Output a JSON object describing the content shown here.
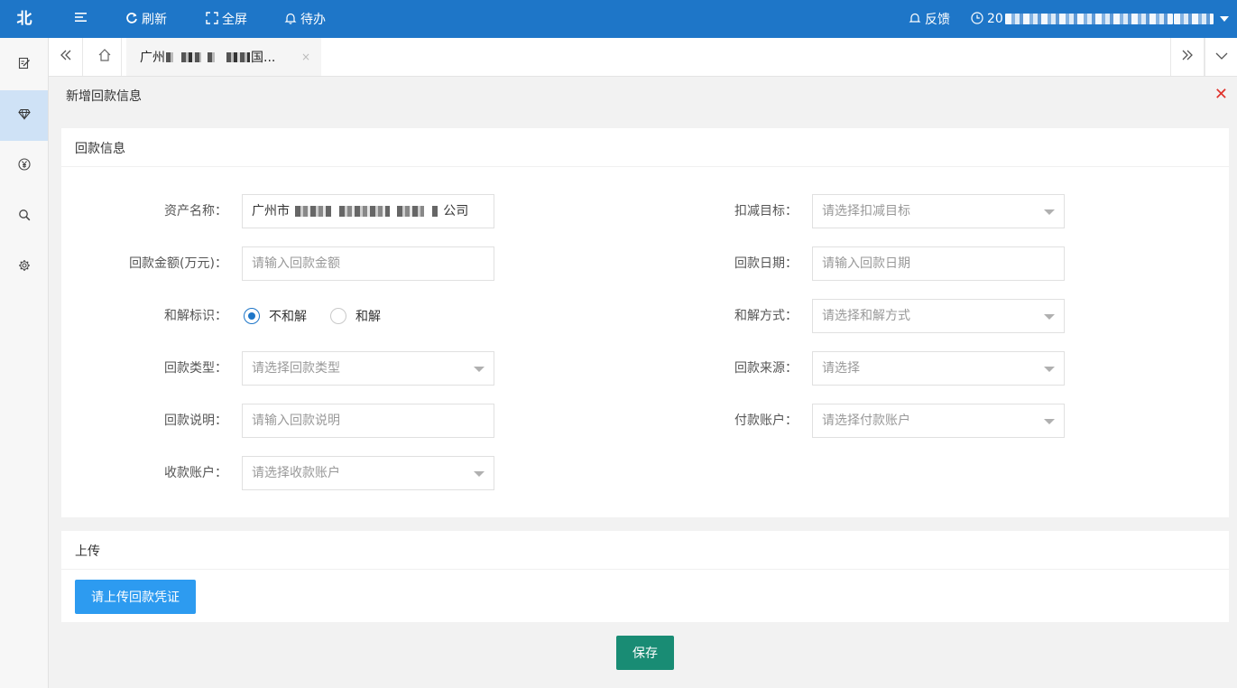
{
  "topbar": {
    "logo": "北",
    "menu_icon": "menu-icon",
    "refresh_label": "刷新",
    "fullscreen_label": "全屏",
    "todo_label": "待办",
    "feedback_label": "反馈",
    "datetime_prefix": "20",
    "bg_color": "#1e76c8"
  },
  "sidebar": {
    "items": [
      {
        "icon": "edit-doc-icon",
        "active": false
      },
      {
        "icon": "diamond-icon",
        "active": true
      },
      {
        "icon": "yen-icon",
        "active": false
      },
      {
        "icon": "search-icon",
        "active": false
      },
      {
        "icon": "gear-icon",
        "active": false
      }
    ]
  },
  "tabs": {
    "active_tab_prefix": "广州",
    "active_tab_suffix": "国...",
    "close_glyph": "×"
  },
  "page": {
    "title": "新增回款信息",
    "close_glyph": "✕"
  },
  "form": {
    "section_title": "回款信息",
    "asset_name_label": "资产名称：",
    "asset_name_prefix": "广州市",
    "asset_name_suffix": "公司",
    "amount_label": "回款金额(万元)：",
    "amount_placeholder": "请输入回款金额",
    "settle_flag_label": "和解标识：",
    "settle_options": [
      "不和解",
      "和解"
    ],
    "settle_selected": "不和解",
    "type_label": "回款类型：",
    "type_placeholder": "请选择回款类型",
    "desc_label": "回款说明：",
    "desc_placeholder": "请输入回款说明",
    "receive_account_label": "收款账户：",
    "receive_account_placeholder": "请选择收款账户",
    "deduct_label": "扣减目标：",
    "deduct_placeholder": "请选择扣减目标",
    "date_label": "回款日期：",
    "date_placeholder": "请输入回款日期",
    "settle_method_label": "和解方式：",
    "settle_method_placeholder": "请选择和解方式",
    "source_label": "回款来源：",
    "source_placeholder": "请选择",
    "pay_account_label": "付款账户：",
    "pay_account_placeholder": "请选择付款账户"
  },
  "upload": {
    "section_title": "上传",
    "button_label": "请上传回款凭证",
    "button_color": "#2d9bf0"
  },
  "actions": {
    "save_label": "保存",
    "save_color": "#198c74"
  }
}
